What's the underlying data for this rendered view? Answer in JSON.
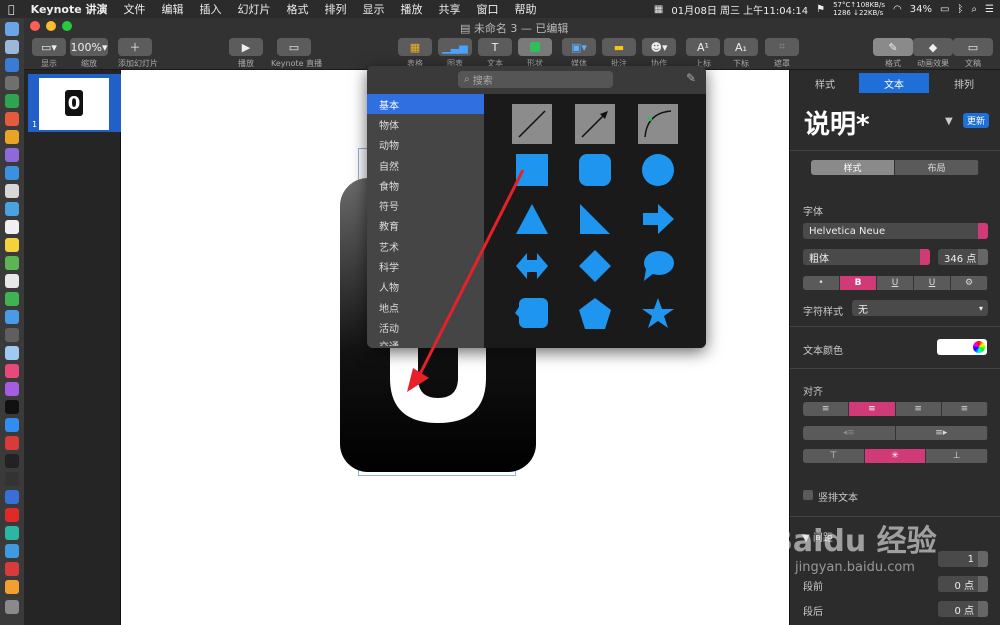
{
  "menubar": {
    "app_name": "Keynote 讲演",
    "menus": [
      "文件",
      "编辑",
      "插入",
      "幻灯片",
      "格式",
      "排列",
      "显示",
      "播放",
      "共享",
      "窗口",
      "帮助"
    ],
    "weather": "57°C",
    "net_up": "108KB/s",
    "net_down": "22KB/s",
    "net_count": "1286",
    "datetime": "01月08日 周三 上午11:04:14",
    "battery": "34%"
  },
  "document": {
    "title": "未命名 3 — 已编辑"
  },
  "toolbar": {
    "view_label": "显示",
    "zoom_value": "100%",
    "zoom_label": "缩放",
    "add_slide_label": "添加幻灯片",
    "play_label": "播放",
    "live_label": "Keynote 直播",
    "table_label": "表格",
    "chart_label": "图表",
    "text_label": "文本",
    "shape_label": "形状",
    "media_label": "媒体",
    "comment_label": "批注",
    "collaborate_label": "协作",
    "superscript_label": "上标",
    "subscript_label": "下标",
    "mask_label": "遮罩",
    "format_label": "格式",
    "animate_label": "动画效果",
    "document_label": "文稿"
  },
  "navigator": {
    "slide_number": "1",
    "thumb_text": "0"
  },
  "popover": {
    "search_placeholder": "搜索",
    "categories": [
      "基本",
      "物体",
      "动物",
      "自然",
      "食物",
      "符号",
      "教育",
      "艺术",
      "科学",
      "人物",
      "地点",
      "活动",
      "交通"
    ],
    "selected_category": "基本",
    "accent_color": "#1e96f0"
  },
  "inspector": {
    "tabs": [
      "样式",
      "文本",
      "排列"
    ],
    "active_tab": "文本",
    "paragraph_style": "说明*",
    "update_button": "更新",
    "subtabs": [
      "样式",
      "布局"
    ],
    "font_heading": "字体",
    "font_family": "Helvetica Neue",
    "font_weight": "粗体",
    "font_size": "346 点",
    "style_buttons": [
      "•",
      "B",
      "U",
      "U",
      "⚙"
    ],
    "char_style_label": "字符样式",
    "char_style_value": "无",
    "text_color_label": "文本颜色",
    "align_heading": "对齐",
    "vertical_text_label": "竖排文本",
    "spacing_heading": "间距",
    "spacing_value": "1",
    "before_label": "段前",
    "before_value": "0 点",
    "after_label": "段后",
    "after_value": "0 点"
  },
  "watermark": {
    "brand": "Baidu 经验",
    "url": "jingyan.baidu.com"
  }
}
